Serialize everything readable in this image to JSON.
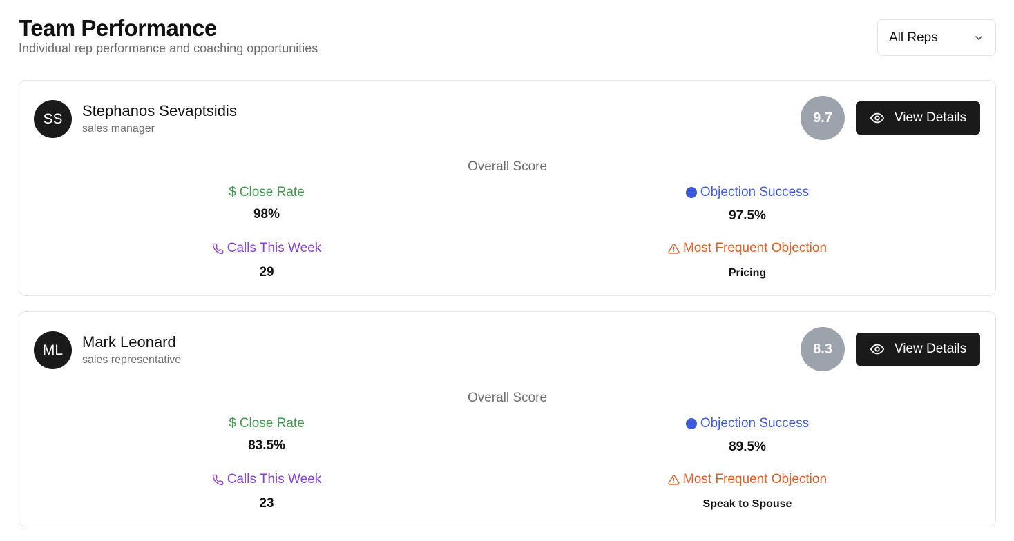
{
  "header": {
    "title": "Team Performance",
    "subtitle": "Individual rep performance and coaching opportunities"
  },
  "filter": {
    "selected": "All Reps",
    "icon": "chevron-down-icon"
  },
  "colors": {
    "close_rate": "#3f9a4a",
    "objection_success": "#3b5bdb",
    "calls": "#8a3fd1",
    "objection": "#df5f26",
    "score_circle": "#9ca3ad",
    "button": "#1a1a1a"
  },
  "reps": [
    {
      "initials": "SS",
      "name": "Stephanos Sevaptsidis",
      "role": "sales manager",
      "score": "9.7",
      "view_label": "View Details",
      "overall_label": "Overall Score",
      "close_rate_label": "Close Rate",
      "close_rate_value": "98%",
      "objection_success_label": "Objection Success",
      "objection_success_value": "97.5%",
      "calls_label": "Calls This Week",
      "calls_value": "29",
      "frequent_objection_label": "Most Frequent Objection",
      "frequent_objection_value": "Pricing"
    },
    {
      "initials": "ML",
      "name": "Mark Leonard",
      "role": "sales representative",
      "score": "8.3",
      "view_label": "View Details",
      "overall_label": "Overall Score",
      "close_rate_label": "Close Rate",
      "close_rate_value": "83.5%",
      "objection_success_label": "Objection Success",
      "objection_success_value": "89.5%",
      "calls_label": "Calls This Week",
      "calls_value": "23",
      "frequent_objection_label": "Most Frequent Objection",
      "frequent_objection_value": "Speak to Spouse"
    }
  ]
}
